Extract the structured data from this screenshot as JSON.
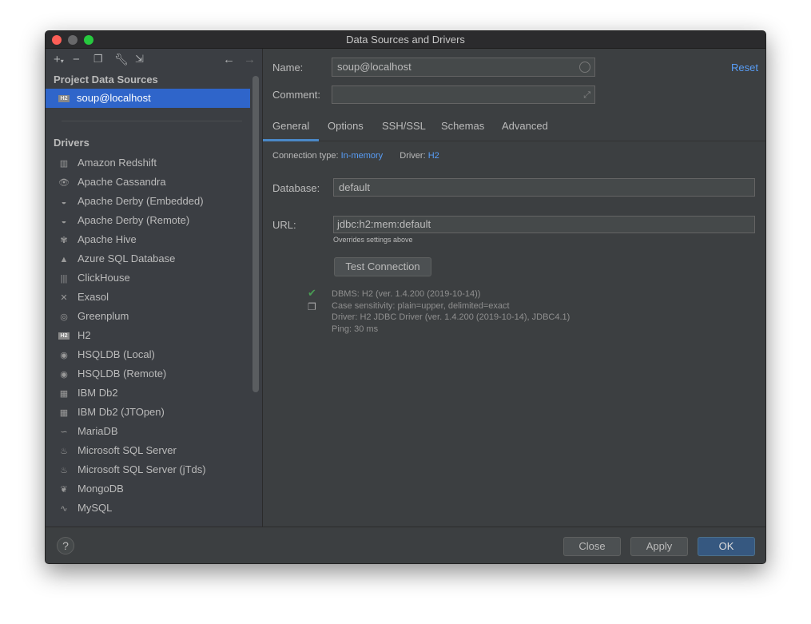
{
  "window": {
    "title": "Data Sources and Drivers"
  },
  "toolbar": {
    "icons": [
      "plus-icon",
      "minus-icon",
      "duplicate-icon",
      "wrench-icon",
      "import-icon",
      "back-arrow-icon",
      "forward-arrow-icon"
    ]
  },
  "sidebar": {
    "project_header": "Project Data Sources",
    "selected_source": {
      "badge": "H2",
      "label": "soup@localhost"
    },
    "drivers_header": "Drivers",
    "drivers": [
      {
        "label": "Amazon Redshift",
        "icon": "▥"
      },
      {
        "label": "Apache Cassandra",
        "icon": "👁"
      },
      {
        "label": "Apache Derby (Embedded)",
        "icon": "◒"
      },
      {
        "label": "Apache Derby (Remote)",
        "icon": "◒"
      },
      {
        "label": "Apache Hive",
        "icon": "✾"
      },
      {
        "label": "Azure SQL Database",
        "icon": "▲"
      },
      {
        "label": "ClickHouse",
        "icon": "|||"
      },
      {
        "label": "Exasol",
        "icon": "✕"
      },
      {
        "label": "Greenplum",
        "icon": "◎"
      },
      {
        "label": "H2",
        "icon": "H2"
      },
      {
        "label": "HSQLDB (Local)",
        "icon": "◉"
      },
      {
        "label": "HSQLDB (Remote)",
        "icon": "◉"
      },
      {
        "label": "IBM Db2",
        "icon": "▦"
      },
      {
        "label": "IBM Db2 (JTOpen)",
        "icon": "▦"
      },
      {
        "label": "MariaDB",
        "icon": "∽"
      },
      {
        "label": "Microsoft SQL Server",
        "icon": "♨"
      },
      {
        "label": "Microsoft SQL Server (jTds)",
        "icon": "♨"
      },
      {
        "label": "MongoDB",
        "icon": "❦"
      },
      {
        "label": "MySQL",
        "icon": "∿"
      }
    ]
  },
  "form": {
    "name_label": "Name:",
    "name_value": "soup@localhost",
    "comment_label": "Comment:",
    "comment_value": "",
    "reset": "Reset",
    "tabs": [
      "General",
      "Options",
      "SSH/SSL",
      "Schemas",
      "Advanced"
    ],
    "active_tab": "General",
    "connection_type_label": "Connection type:",
    "connection_type": "In-memory",
    "driver_label": "Driver:",
    "driver": "H2",
    "database_label": "Database:",
    "database_value": "default",
    "url_label": "URL:",
    "url_value": "jdbc:h2:mem:default",
    "url_hint": "Overrides settings above",
    "test_connection": "Test Connection",
    "status_lines": [
      "DBMS: H2 (ver. 1.4.200 (2019-10-14))",
      "Case sensitivity: plain=upper, delimited=exact",
      "Driver: H2 JDBC Driver (ver. 1.4.200 (2019-10-14), JDBC4.1)",
      "Ping: 30 ms"
    ]
  },
  "footer": {
    "help": "?",
    "close": "Close",
    "apply": "Apply",
    "ok": "OK"
  },
  "colors": {
    "accent": "#2f65ca",
    "link": "#589df6",
    "success": "#499c54"
  }
}
